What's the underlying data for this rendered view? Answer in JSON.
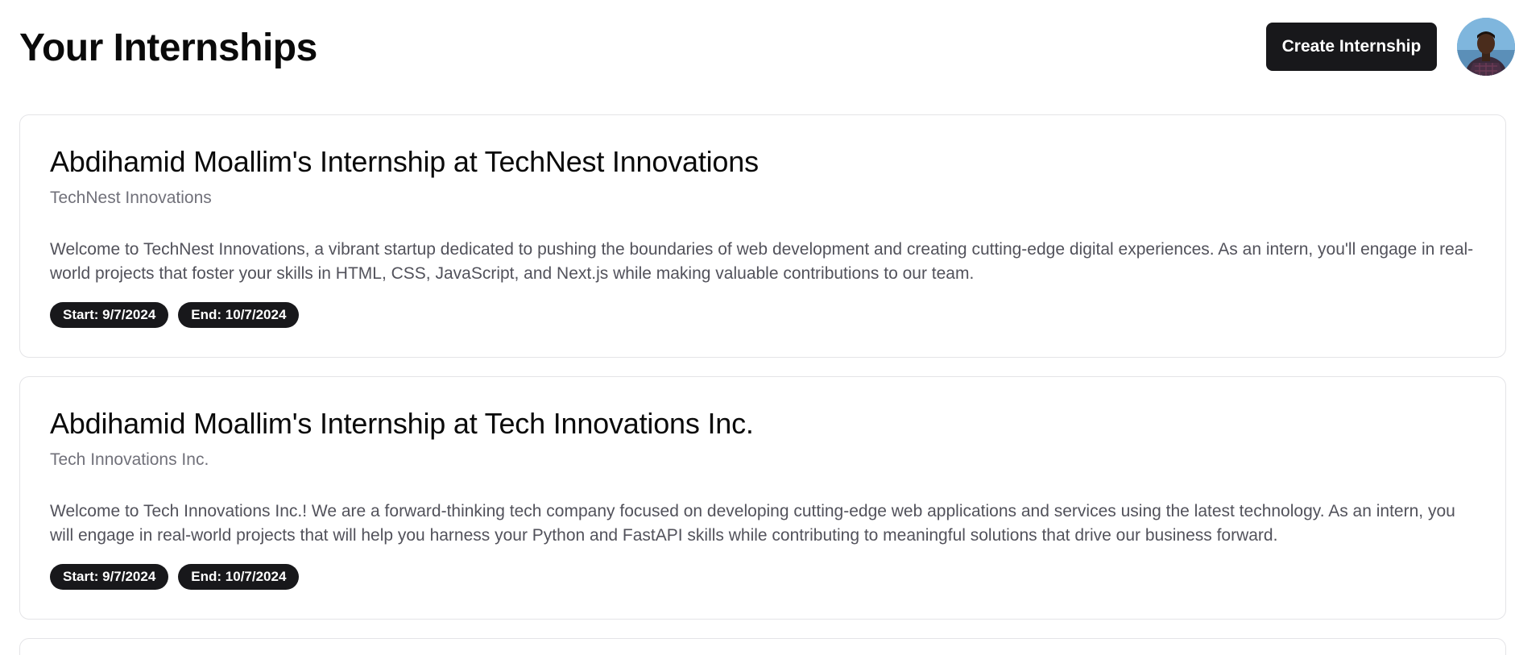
{
  "header": {
    "title": "Your Internships",
    "create_label": "Create Internship",
    "avatar_icon": "user-avatar"
  },
  "internships": [
    {
      "title": "Abdihamid Moallim's Internship at TechNest Innovations",
      "company": "TechNest Innovations",
      "description": "Welcome to TechNest Innovations, a vibrant startup dedicated to pushing the boundaries of web development and creating cutting-edge digital experiences. As an intern, you'll engage in real-world projects that foster your skills in HTML, CSS, JavaScript, and Next.js while making valuable contributions to our team.",
      "start": "Start: 9/7/2024",
      "end": "End: 10/7/2024"
    },
    {
      "title": "Abdihamid Moallim's Internship at Tech Innovations Inc.",
      "company": "Tech Innovations Inc.",
      "description": "Welcome to Tech Innovations Inc.! We are a forward-thinking tech company focused on developing cutting-edge web applications and services using the latest technology. As an intern, you will engage in real-world projects that will help you harness your Python and FastAPI skills while contributing to meaningful solutions that drive our business forward.",
      "start": "Start: 9/7/2024",
      "end": "End: 10/7/2024"
    }
  ],
  "colors": {
    "accent": "#18181b",
    "muted_text": "#71717a",
    "body_text": "#52525b",
    "card_border": "#e4e4e7"
  }
}
